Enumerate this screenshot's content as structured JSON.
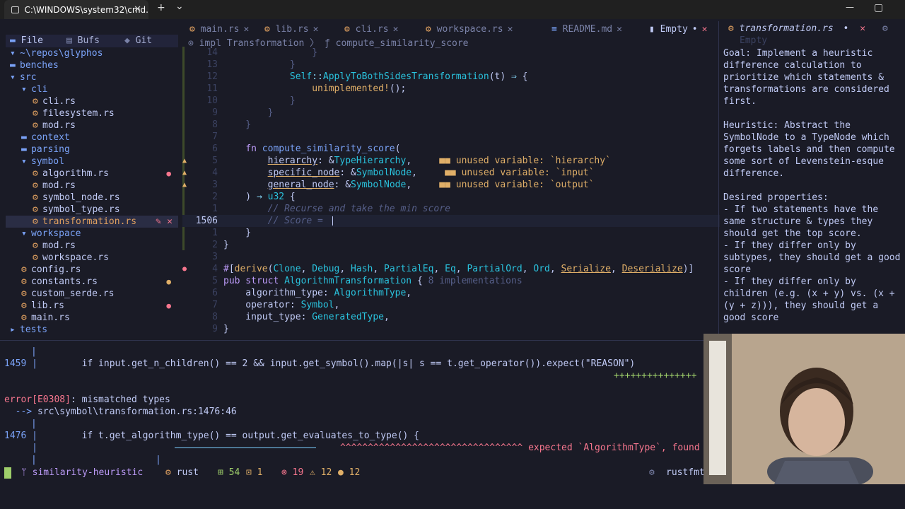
{
  "window": {
    "tab_title": "C:\\WINDOWS\\system32\\cmd.",
    "new_tab": "+",
    "dropdown": "⌄",
    "close": "✕",
    "min": "—",
    "max": "▢"
  },
  "file_tabs": [
    {
      "label": "main.rs",
      "close": "✕"
    },
    {
      "label": "lib.rs",
      "close": "✕"
    },
    {
      "label": "cli.rs",
      "close": "✕"
    },
    {
      "label": "workspace.rs",
      "close": "✕"
    },
    {
      "label": "README.md",
      "close": "✕"
    },
    {
      "label": "Empty",
      "modified": "•",
      "close": "✕"
    }
  ],
  "sidebar": {
    "tabs": [
      "File",
      "Bufs",
      "Git"
    ],
    "root": "~\\repos\\glyphos",
    "items": [
      {
        "label": "benches",
        "kind": "dir"
      },
      {
        "label": "src",
        "kind": "dir"
      },
      {
        "label": "cli",
        "kind": "dir"
      },
      {
        "label": "cli.rs",
        "kind": "file"
      },
      {
        "label": "filesystem.rs",
        "kind": "file"
      },
      {
        "label": "mod.rs",
        "kind": "file"
      },
      {
        "label": "context",
        "kind": "dir"
      },
      {
        "label": "parsing",
        "kind": "dir"
      },
      {
        "label": "symbol",
        "kind": "dir"
      },
      {
        "label": "algorithm.rs",
        "kind": "file"
      },
      {
        "label": "mod.rs",
        "kind": "file"
      },
      {
        "label": "symbol_node.rs",
        "kind": "file"
      },
      {
        "label": "symbol_type.rs",
        "kind": "file"
      },
      {
        "label": "transformation.rs",
        "kind": "file"
      },
      {
        "label": "workspace",
        "kind": "dir"
      },
      {
        "label": "mod.rs",
        "kind": "file"
      },
      {
        "label": "workspace.rs",
        "kind": "file"
      },
      {
        "label": "config.rs",
        "kind": "file"
      },
      {
        "label": "constants.rs",
        "kind": "file"
      },
      {
        "label": "custom_serde.rs",
        "kind": "file"
      },
      {
        "label": "lib.rs",
        "kind": "file"
      },
      {
        "label": "main.rs",
        "kind": "file"
      },
      {
        "label": "tests",
        "kind": "dir"
      }
    ]
  },
  "breadcrumb": "⊙ impl Transformation 〉 ƒ compute_similarity_score",
  "code_lines": [
    {
      "n": "14",
      "text": "                }"
    },
    {
      "n": "13",
      "text": "            }"
    },
    {
      "n": "12",
      "text": "            Self::ApplyToBothSidesTransformation(t) ⇒ {"
    },
    {
      "n": "11",
      "text": "                unimplemented!();"
    },
    {
      "n": "10",
      "text": "            }"
    },
    {
      "n": "9",
      "text": "        }"
    },
    {
      "n": "8",
      "text": "    }"
    },
    {
      "n": "7",
      "text": ""
    },
    {
      "n": "6",
      "text": "    fn compute_similarity_score("
    },
    {
      "n": "5",
      "text": "        hierarchy: &TypeHierarchy,"
    },
    {
      "n": "4",
      "text": "        specific_node: &SymbolNode,"
    },
    {
      "n": "3",
      "text": "        general_node: &SymbolNode,"
    },
    {
      "n": "2",
      "text": "    ) → u32 {"
    },
    {
      "n": "1",
      "text": "        // Recurse and take the min score"
    },
    {
      "n": "1506",
      "text": "        // Score = "
    },
    {
      "n": "1",
      "text": "    }"
    },
    {
      "n": "2",
      "text": "}"
    },
    {
      "n": "3",
      "text": ""
    },
    {
      "n": "4",
      "text": "#[derive(Clone, Debug, Hash, PartialEq, Eq, PartialOrd, Ord, Serialize, Deserialize)]"
    },
    {
      "n": "5",
      "text": "pub struct AlgorithmTransformation { 8 implementations"
    },
    {
      "n": "6",
      "text": "    algorithm_type: AlgorithmType,"
    },
    {
      "n": "7",
      "text": "    operator: Symbol,"
    },
    {
      "n": "8",
      "text": "    input_type: GeneratedType,"
    },
    {
      "n": "9",
      "text": "}"
    }
  ],
  "inlay_hints": {
    "hierarchy": "unused variable: `hierarchy`",
    "input": "unused variable: `input`",
    "output": "unused variable: `output`"
  },
  "right_panel": {
    "tab_label": "transformation.rs",
    "tab_modified": "•",
    "tab_close": "✕",
    "subtitle": "Empty",
    "paragraphs": [
      "Goal: Implement a heuristic difference calculation to prioritize which statements & transformations are considered first.",
      "Heuristic: Abstract the SymbolNode to a TypeNode which forgets labels and then compute some sort of Levenstein-esque difference.",
      "Desired properties:\n- If two statements have the same structure & types they should get the top score.\n- If they differ only by subtypes, they should get a good score\n- If they differ only by children (e.g. (x + y) vs. (x + (y + z))), they should get a good score"
    ]
  },
  "terminal": {
    "line1_num": "1459",
    "line1_code": "        if input.get_n_children() == 2 && input.get_symbol().map(|s| s == t.get_operator()).expect(\"REASON\")",
    "line1_plus": "+++++++++++++++",
    "error_code": "error[E0308]",
    "error_msg": ": mismatched types",
    "arrow": "  --> ",
    "location": "src\\symbol\\transformation.rs:1476:46",
    "line2_num": "1476",
    "line2_code": "        if t.get_algorithm_type() == output.get_evaluates_to_type() {",
    "carets": "^^^^^^^^^^^^^^^^^^^^^^^^^^^^^^^^^",
    "expected": "expected `AlgorithmType`, found `Type`"
  },
  "status": {
    "branch": "similarity-heuristic",
    "lang": "rust",
    "added": "54",
    "changed": "1",
    "errors": "19",
    "warnings": "12",
    "hints": "12",
    "formatter": "rustfmt"
  },
  "colors": {
    "bg": "#1a1b26",
    "accent": "#7aa2f7",
    "error": "#f7768e",
    "warning": "#e0af68",
    "ok": "#9ece6a"
  }
}
